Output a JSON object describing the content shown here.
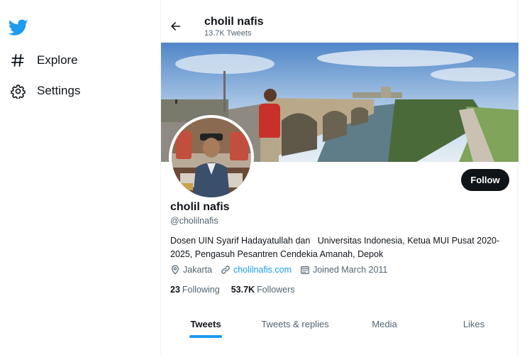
{
  "nav": {
    "items": [
      {
        "label": "Explore",
        "icon": "hashtag-icon"
      },
      {
        "label": "Settings",
        "icon": "gear-icon"
      }
    ]
  },
  "header": {
    "name": "cholil nafis",
    "tweet_count": "13.7K Tweets"
  },
  "profile": {
    "name": "cholil nafis",
    "handle": "@cholilnafis",
    "bio": "Dosen UIN Syarif Hadayatullah dan   Universitas Indonesia, Ketua MUI Pusat 2020-\n2025, Pengasuh Pesantren Cendekia Amanah, Depok",
    "location": "Jakarta",
    "website": "cholilnafis.com",
    "joined": "Joined March 2011",
    "following_count": "23",
    "following_label": "Following",
    "followers_count": "53.7K",
    "followers_label": "Followers",
    "follow_label": "Follow"
  },
  "tabs": [
    {
      "label": "Tweets",
      "active": true
    },
    {
      "label": "Tweets & replies",
      "active": false
    },
    {
      "label": "Media",
      "active": false
    },
    {
      "label": "Likes",
      "active": false
    }
  ],
  "colors": {
    "accent": "#1d9bf0",
    "text": "#0f1419",
    "muted": "#536471"
  }
}
